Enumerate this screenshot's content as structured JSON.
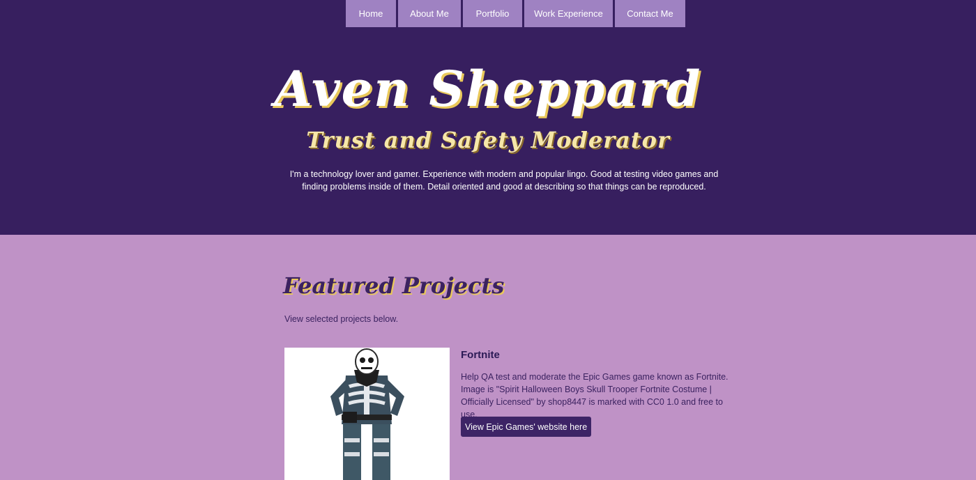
{
  "nav": {
    "items": [
      {
        "label": "Home"
      },
      {
        "label": "About Me"
      },
      {
        "label": "Portfolio"
      },
      {
        "label": "Work Experience"
      },
      {
        "label": "Contact Me"
      }
    ]
  },
  "hero": {
    "name": "Aven Sheppard",
    "role": "Trust and Safety Moderator",
    "bio": "I'm a technology lover and gamer. Experience with modern and popular lingo. Good at testing video games and finding problems inside of them. Detail oriented and good at describing so that things can be reproduced."
  },
  "featured": {
    "title": "Featured Projects",
    "subtitle": "View selected projects below."
  },
  "project": {
    "title": "Fortnite",
    "description": "Help QA test and moderate the Epic Games game known as Fortnite. Image is \"Spirit Halloween Boys Skull Trooper Fortnite Costume | Officially Licensed\" by shop8447 is marked with CC0 1.0 and free to use.",
    "button_label": "View Epic Games' website here",
    "image_icon": "skull-trooper-costume"
  },
  "colors": {
    "header_bg": "#371f5f",
    "nav_bg": "#9f82c2",
    "body_bg": "#bf92c6",
    "button_bg": "#3d2466",
    "accent": "#e9c85a"
  }
}
